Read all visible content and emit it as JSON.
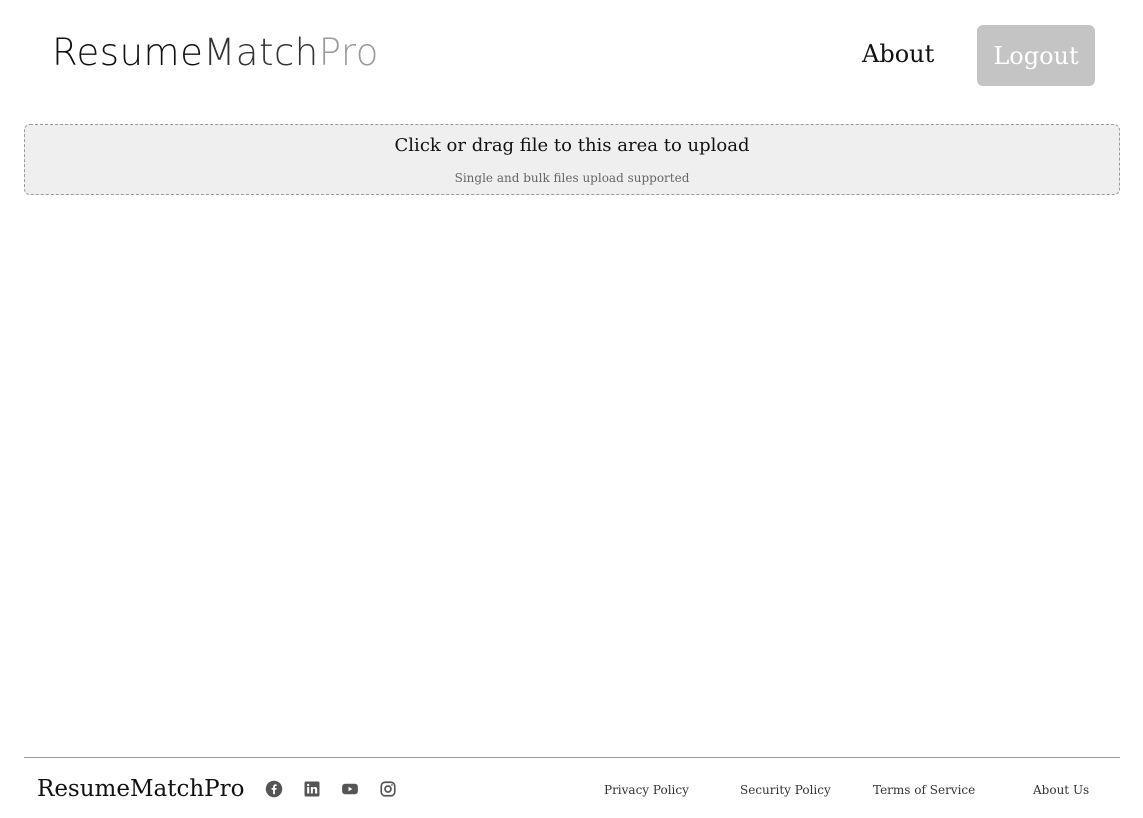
{
  "header": {
    "logo": {
      "part1": "Resume",
      "part2": "Match",
      "part3": "Pro"
    },
    "nav_about": "About",
    "logout_label": "Logout"
  },
  "upload": {
    "title": "Click or drag file to this area to upload",
    "hint": "Single and bulk files upload supported"
  },
  "footer": {
    "logo": "ResumeMatchPro",
    "social_icons": [
      "facebook-icon",
      "linkedin-icon",
      "youtube-icon",
      "instagram-icon"
    ],
    "links": {
      "privacy": "Privacy Policy",
      "security": "Security Policy",
      "terms": "Terms of Service",
      "about_us": "About Us"
    }
  },
  "colors": {
    "logout_bg": "#c4c4c4",
    "dropzone_bg": "#efefef",
    "logo_accent": "#9a9a9a",
    "icon_color": "#555555"
  }
}
